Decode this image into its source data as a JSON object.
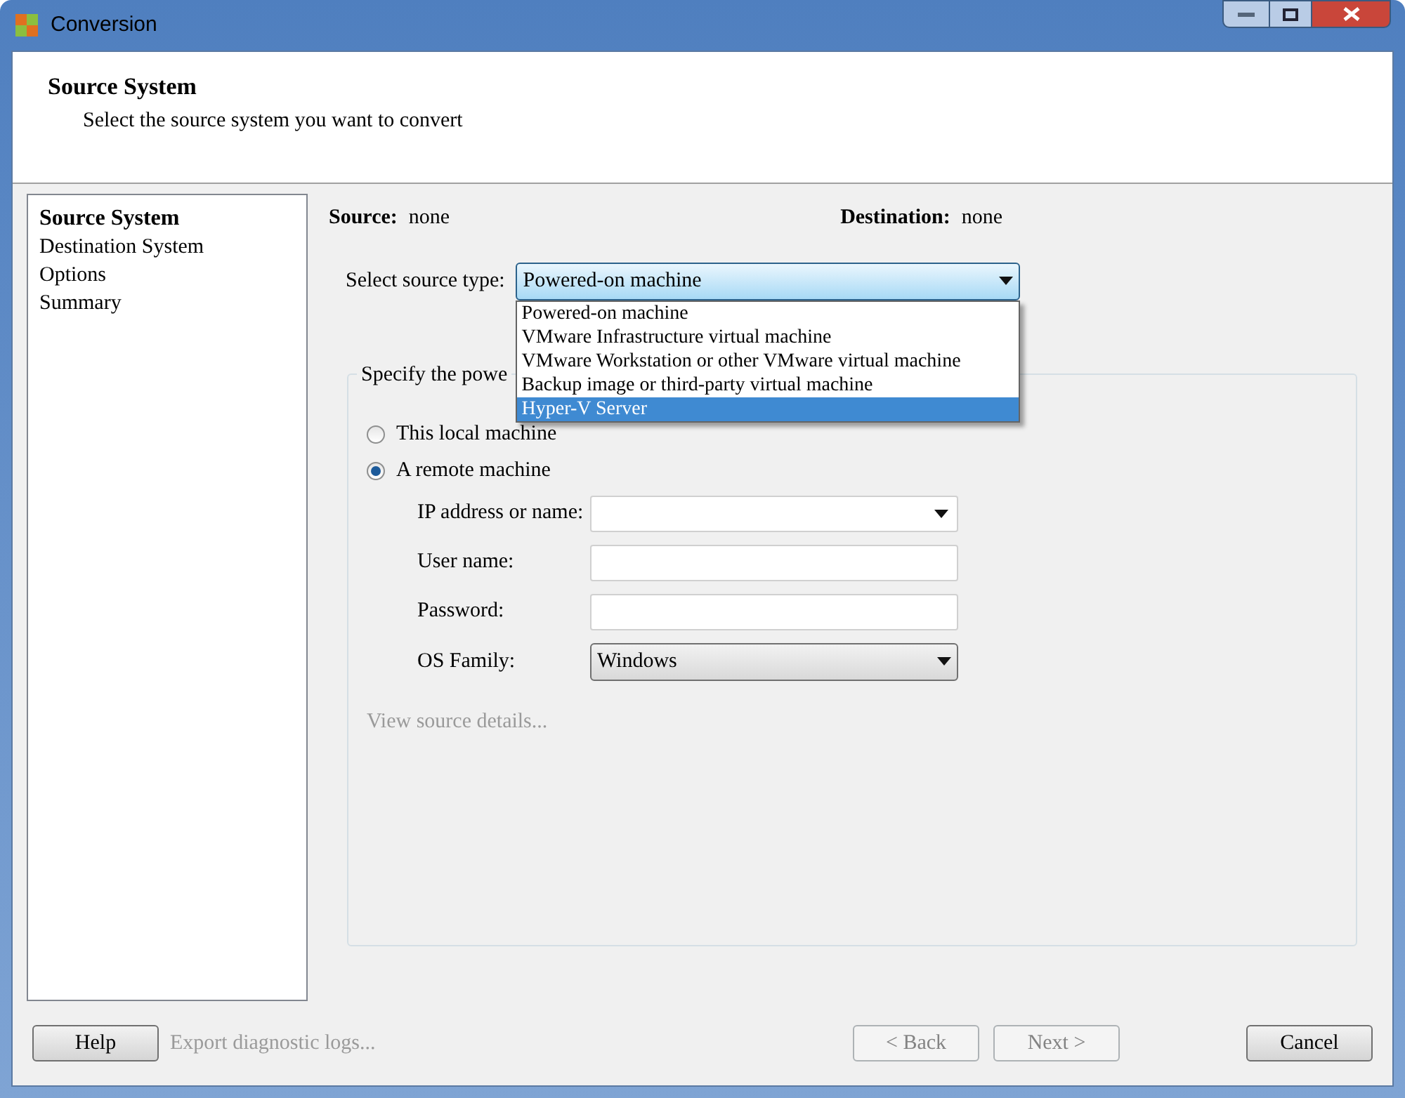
{
  "window": {
    "title": "Conversion"
  },
  "header": {
    "title": "Source System",
    "subtitle": "Select the source system you want to convert"
  },
  "nav": [
    {
      "label": "Source System",
      "selected": true
    },
    {
      "label": "Destination System",
      "selected": false
    },
    {
      "label": "Options",
      "selected": false
    },
    {
      "label": "Summary",
      "selected": false
    }
  ],
  "summary": {
    "source_label": "Source:",
    "source_value": "none",
    "destination_label": "Destination:",
    "destination_value": "none"
  },
  "source_type": {
    "label": "Select source type:",
    "value": "Powered-on machine",
    "expanded": true,
    "options": [
      {
        "label": "Powered-on machine",
        "highlighted": false
      },
      {
        "label": "VMware Infrastructure virtual machine",
        "highlighted": false
      },
      {
        "label": "VMware Workstation or other VMware virtual machine",
        "highlighted": false
      },
      {
        "label": "Backup image or third-party virtual machine",
        "highlighted": false
      },
      {
        "label": "Hyper-V Server",
        "highlighted": true
      }
    ]
  },
  "group": {
    "legend": "Specify the powe",
    "radios": [
      {
        "label": "This local machine",
        "selected": false
      },
      {
        "label": "A remote machine",
        "selected": true
      }
    ],
    "fields": [
      {
        "kind": "combo",
        "label": "IP address or name:"
      },
      {
        "kind": "text",
        "label": "User name:"
      },
      {
        "kind": "password",
        "label": "Password:"
      },
      {
        "kind": "select",
        "label": "OS Family:",
        "value": "Windows"
      }
    ],
    "link": {
      "label": "View source details...",
      "disabled": true
    }
  },
  "footer": {
    "help": "Help",
    "export": {
      "label": "Export diagnostic logs...",
      "disabled": true
    },
    "buttons": [
      {
        "label": "< Back",
        "disabled": true
      },
      {
        "label": "Next >",
        "disabled": true
      },
      {
        "label": "Cancel",
        "disabled": false
      }
    ]
  }
}
